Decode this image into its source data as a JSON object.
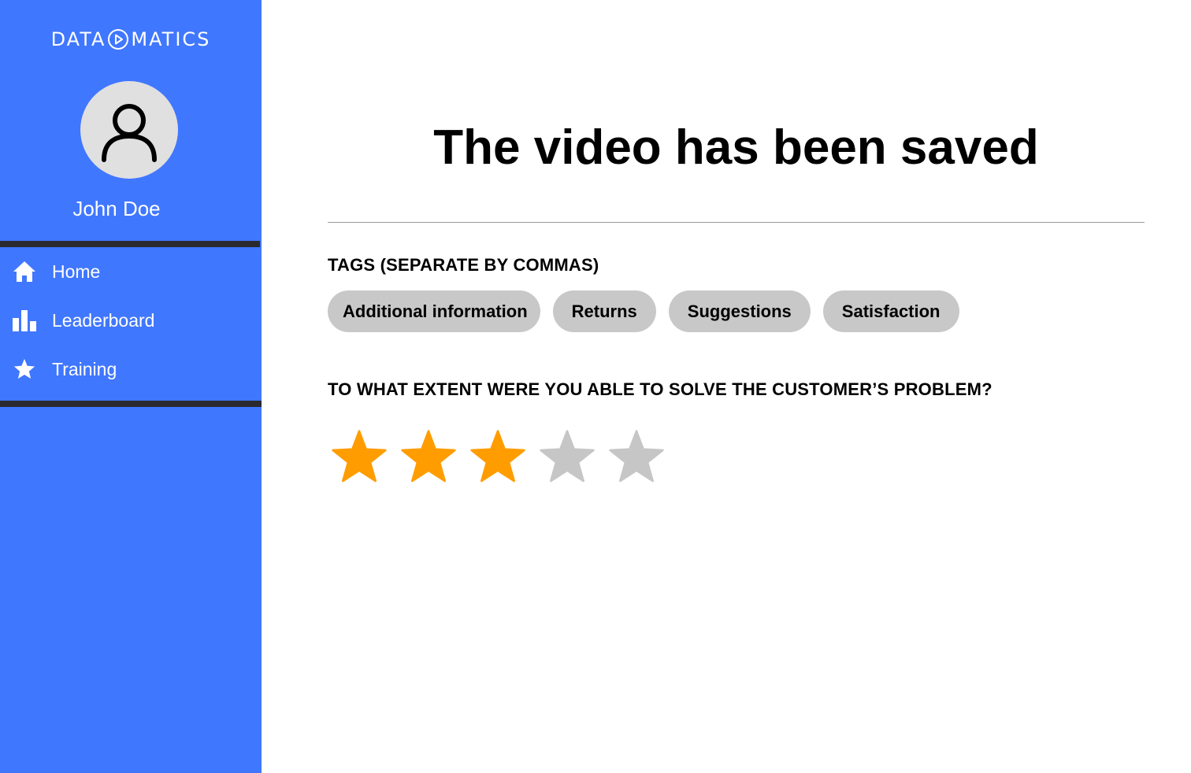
{
  "brand": {
    "logo_left": "DATA",
    "logo_right": "MATICS"
  },
  "user": {
    "name": "John Doe"
  },
  "sidebar": {
    "items": [
      {
        "label": "Home",
        "icon": "home-icon"
      },
      {
        "label": "Leaderboard",
        "icon": "bar-chart-icon"
      },
      {
        "label": "Training",
        "icon": "star-icon"
      }
    ]
  },
  "main": {
    "title": "The video has been saved",
    "tags_label": "TAGS (SEPARATE BY COMMAS)",
    "tags": [
      "Additional information",
      "Returns",
      "Suggestions",
      "Satisfaction"
    ],
    "question": "TO WHAT EXTENT WERE YOU ABLE TO SOLVE THE CUSTOMER’S PROBLEM?",
    "rating": {
      "value": 3,
      "max": 5
    }
  },
  "colors": {
    "sidebar_bg": "#4077ff",
    "divider": "#2a2a2e",
    "star_filled": "#ff9d00",
    "star_empty": "#c6c6c6",
    "tag_bg": "#c8c8c8"
  }
}
